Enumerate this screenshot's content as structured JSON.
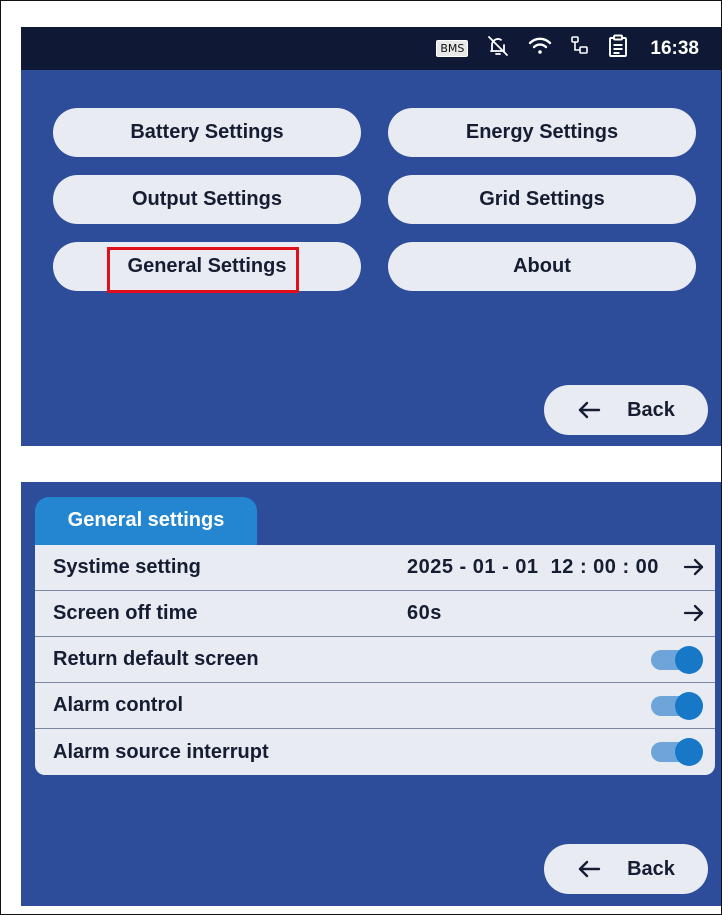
{
  "screen1": {
    "status": {
      "bms_label": "BMS",
      "time": "16:38"
    },
    "menu": [
      {
        "label": "Battery Settings"
      },
      {
        "label": "Energy Settings"
      },
      {
        "label": "Output Settings"
      },
      {
        "label": "Grid Settings"
      },
      {
        "label": "General Settings"
      },
      {
        "label": "About"
      }
    ],
    "back_label": "Back"
  },
  "screen2": {
    "tab_title": "General settings",
    "rows": [
      {
        "label": "Systime setting",
        "value": "2025 - 01 - 01  12 : 00 : 00"
      },
      {
        "label": "Screen off time",
        "value": "60s"
      },
      {
        "label": "Return default screen",
        "toggle": "on"
      },
      {
        "label": "Alarm control",
        "toggle": "on"
      },
      {
        "label": "Alarm source interrupt",
        "toggle": "on"
      }
    ],
    "back_label": "Back"
  },
  "colors": {
    "screen_bg": "#2d4c99",
    "status_bar": "#0f1834",
    "button_bg": "#e9ebf2",
    "tab_bg": "#2486d0",
    "toggle_knob": "#1778c8",
    "highlight": "#e0101a"
  }
}
